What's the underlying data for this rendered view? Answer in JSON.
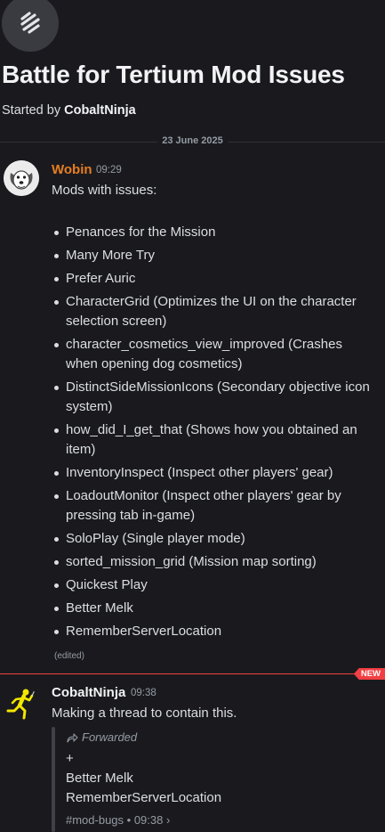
{
  "thread": {
    "title": "Battle for Tertium Mod Issues",
    "started_prefix": "Started by",
    "started_by": "CobaltNinja",
    "date": "23 June 2025"
  },
  "messages": [
    {
      "author": "Wobin",
      "author_color": "#e67e22",
      "time": "09:29",
      "intro": "Mods with issues:",
      "items": [
        "Penances for the Mission",
        "Many More Try",
        "Prefer Auric",
        "CharacterGrid (Optimizes the UI on the character selection screen)",
        "character_cosmetics_view_improved (Crashes when opening dog cosmetics)",
        "DistinctSideMissionIcons (Secondary objective icon system)",
        "how_did_I_get_that (Shows how you obtained an item)",
        "InventoryInspect (Inspect other players' gear)",
        "LoadoutMonitor (Inspect other players' gear by pressing tab in-game)",
        "SoloPlay (Single player mode)",
        "sorted_mission_grid (Mission map sorting)",
        "Quickest Play",
        "Better Melk",
        "RememberServerLocation"
      ],
      "edited": "(edited)"
    },
    {
      "author": "CobaltNinja",
      "time": "09:38",
      "text": "Making a thread to contain this.",
      "forwarded_label": "Forwarded",
      "forwarded_lines": [
        "+",
        "Better Melk",
        "RememberServerLocation"
      ],
      "forwarded_source": "#mod-bugs • 09:38 ›"
    }
  ],
  "new_badge": "NEW",
  "colors": {
    "new_accent": "#f23f43",
    "background": "#1a1a1e"
  }
}
